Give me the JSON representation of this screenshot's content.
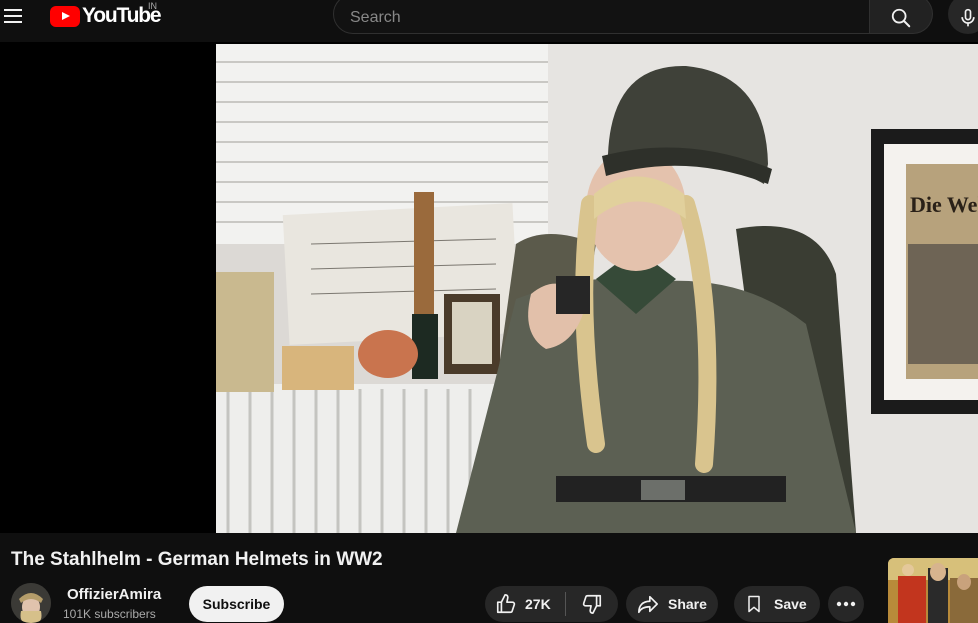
{
  "header": {
    "logo_text": "YouTube",
    "country_code": "IN",
    "search_placeholder": "Search"
  },
  "video": {
    "title": "The Stahlhelm - German Helmets in WW2",
    "frame_poster_text": "Die Wehrm"
  },
  "channel": {
    "name": "OffizierAmira",
    "subscribers": "101K subscribers",
    "subscribe_label": "Subscribe"
  },
  "actions": {
    "like_count": "27K",
    "share_label": "Share",
    "save_label": "Save"
  },
  "colors": {
    "background": "#0f0f0f",
    "brand_red": "#ff0000",
    "pill_bg": "#272727",
    "subscribe_bg": "#f1f1f1"
  },
  "icons": [
    "menu-icon",
    "youtube-logo-icon",
    "search-icon",
    "mic-icon",
    "like-icon",
    "dislike-icon",
    "share-icon",
    "save-icon",
    "more-icon"
  ]
}
